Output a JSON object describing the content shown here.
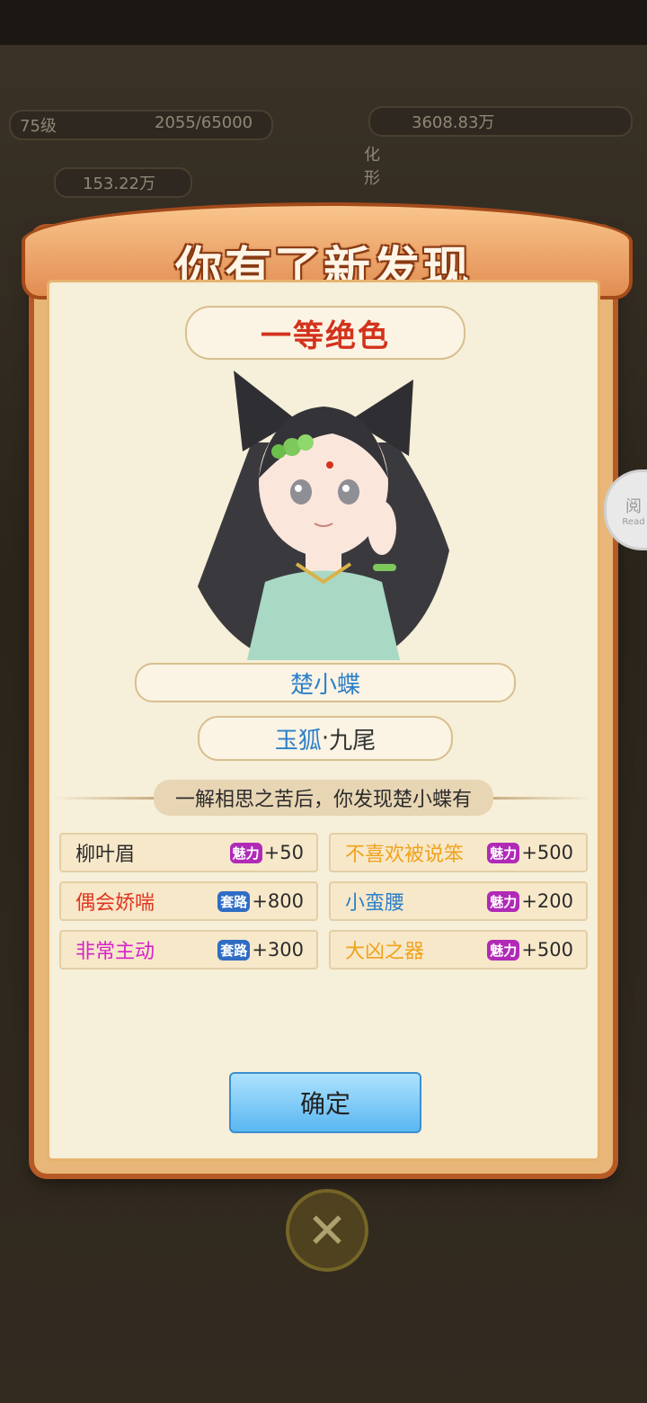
{
  "background": {
    "hud_left_level": "75级",
    "hud_exp": "2055/65000",
    "hud_coins": "153.22万",
    "hud_right_power": "3608.83万",
    "hud_right_side": "化形"
  },
  "modal": {
    "title": "你有了新发现",
    "rank": "一等绝色",
    "name": "楚小蝶",
    "race_part1": "玉狐",
    "race_sep": "·",
    "race_part2": "九尾",
    "discover_text": "一解相思之苦后，你发现楚小蝶有",
    "traits": [
      {
        "label": "柳叶眉",
        "color": "#2b2b2b",
        "stat_icon": "charm-icon",
        "stat_icon_text": "魅力",
        "value": "+50"
      },
      {
        "label": "不喜欢被说笨",
        "color": "#f0a21e",
        "stat_icon": "charm-icon",
        "stat_icon_text": "魅力",
        "value": "+500"
      },
      {
        "label": "偶会娇喘",
        "color": "#e0341f",
        "stat_icon": "skill-icon",
        "stat_icon_text": "套路",
        "value": "+800"
      },
      {
        "label": "小蛮腰",
        "color": "#2d7fc9",
        "stat_icon": "charm-icon",
        "stat_icon_text": "魅力",
        "value": "+200"
      },
      {
        "label": "非常主动",
        "color": "#d623c9",
        "stat_icon": "skill-icon",
        "stat_icon_text": "套路",
        "value": "+300"
      },
      {
        "label": "大凶之器",
        "color": "#f0a21e",
        "stat_icon": "charm-icon",
        "stat_icon_text": "魅力",
        "value": "+500"
      }
    ],
    "confirm_label": "确定"
  },
  "overlay": {
    "close_glyph": "✕",
    "reader_badge": "阅",
    "reader_badge_small": "Read"
  },
  "colors": {
    "frame": "#e7b678",
    "frame_edge": "#b65a25",
    "panel": "#f6efd9",
    "rank_red": "#d3321c",
    "name_blue": "#2d7fc9",
    "button_blue": "#59b7f0"
  }
}
